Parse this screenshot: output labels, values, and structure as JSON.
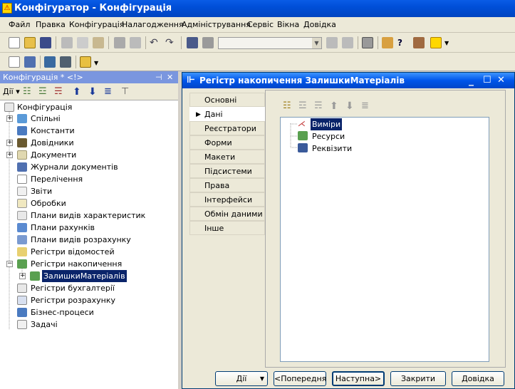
{
  "window": {
    "title": "Конфігуратор - Конфігурація",
    "app_icon": "app-logo-icon"
  },
  "menu": [
    "Файл",
    "Правка",
    "Конфігурація",
    "Налагодження",
    "Адміністрування",
    "Сервіс",
    "Вікна",
    "Довідка"
  ],
  "toolbar": {
    "search_value": ""
  },
  "left_panel": {
    "title": "Конфігурація * <!>",
    "actions_label": "Дії",
    "tree": [
      "Конфігурація",
      "Спільні",
      "Константи",
      "Довідники",
      "Документи",
      "Журнали документів",
      "Перелічення",
      "Звіти",
      "Обробки",
      "Плани видів характеристик",
      "Плани рахунків",
      "Плани видів розрахунку",
      "Регістри відомостей",
      "Регістри накопичення",
      "ЗалишкиМатеріалів",
      "Регістри бухгалтерії",
      "Регістри розрахунку",
      "Бізнес-процеси",
      "Задачі"
    ]
  },
  "dialog": {
    "title": "Регістр накопичення ЗалишкиМатеріалів",
    "tabs": [
      "Основні",
      "Дані",
      "Реєстратори",
      "Форми",
      "Макети",
      "Підсистеми",
      "Права",
      "Інтерфейси",
      "Обмін даними",
      "Інше"
    ],
    "active_tab": "Дані",
    "data_tree": [
      "Виміри",
      "Ресурси",
      "Реквізити"
    ],
    "buttons": {
      "actions": "Дії",
      "prev": "<Попередня",
      "next": "Наступна>",
      "close": "Закрити",
      "help": "Довідка"
    }
  }
}
